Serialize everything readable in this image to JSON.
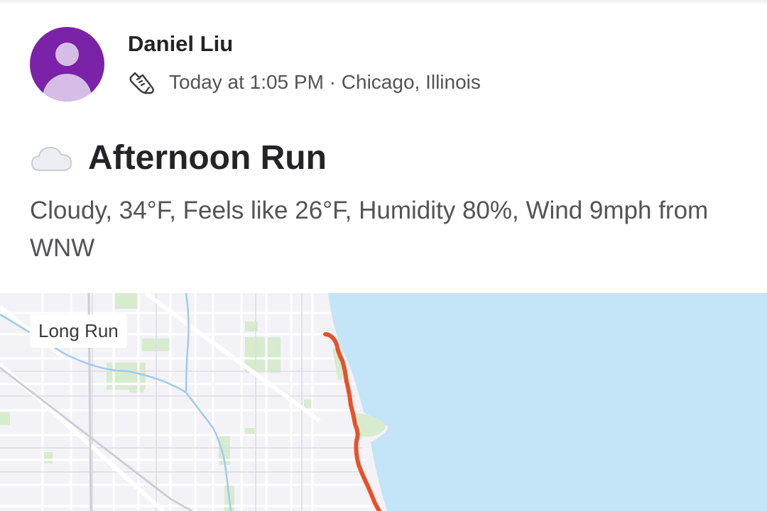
{
  "activity": {
    "athlete_name": "Daniel Liu",
    "sport_icon": "running-shoe-icon",
    "meta_text": "Today at 1:05 PM · Chicago, Illinois",
    "weather_icon": "cloud-icon",
    "title": "Afternoon Run",
    "description": "Cloudy, 34°F, Feels like 26°F, Humidity 80%, Wind 9mph from WNW"
  },
  "map": {
    "tag_label": "Long Run",
    "route_color": "#e8512a",
    "water_color": "#c4e4f8",
    "park_color": "#d7ebcf",
    "road_color": "#ffffff"
  }
}
